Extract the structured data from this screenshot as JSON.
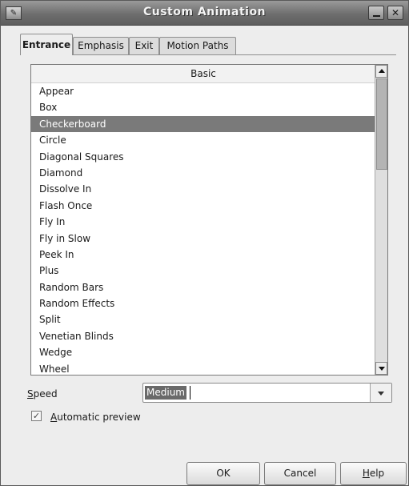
{
  "window": {
    "title": "Custom Animation"
  },
  "tabs": [
    {
      "label": "Entrance",
      "active": true
    },
    {
      "label": "Emphasis",
      "active": false
    },
    {
      "label": "Exit",
      "active": false
    },
    {
      "label": "Motion Paths",
      "active": false
    }
  ],
  "effects": {
    "category": "Basic",
    "selected": "Checkerboard",
    "items": [
      "Appear",
      "Box",
      "Checkerboard",
      "Circle",
      "Diagonal Squares",
      "Diamond",
      "Dissolve In",
      "Flash Once",
      "Fly In",
      "Fly in Slow",
      "Peek In",
      "Plus",
      "Random Bars",
      "Random Effects",
      "Split",
      "Venetian Blinds",
      "Wedge",
      "Wheel"
    ]
  },
  "speed": {
    "label_mnemonic": "S",
    "label_rest": "peed",
    "value": "Medium"
  },
  "preview": {
    "checked": true,
    "checkmark": "✓",
    "label_mnemonic": "A",
    "label_rest": "utomatic preview"
  },
  "buttons": {
    "ok": "OK",
    "cancel": "Cancel",
    "help_mnemonic": "H",
    "help_rest": "elp"
  },
  "colors": {
    "selection": "#7a7a7a",
    "titlebar": "#6e6e6e"
  }
}
